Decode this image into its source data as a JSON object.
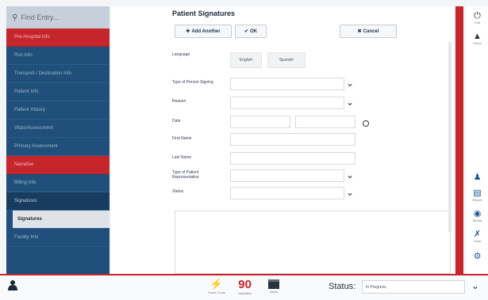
{
  "sidebar": {
    "search_placeholder": "Find Entry...",
    "items": [
      {
        "label": "Pre-Hospital Info"
      },
      {
        "label": "Run Info"
      },
      {
        "label": "Transport / Destination Info"
      },
      {
        "label": "Patient Info"
      },
      {
        "label": "Patient History"
      },
      {
        "label": "Vitals/Assessment"
      },
      {
        "label": "Primary Assessment"
      },
      {
        "label": "Narrative"
      },
      {
        "label": "Billing Info"
      },
      {
        "label": "Signatures"
      },
      {
        "label": "Signatures"
      },
      {
        "label": "Facility Info"
      }
    ]
  },
  "main": {
    "title": "Patient Signatures",
    "add_another": "Add Another",
    "ok": "OK",
    "cancel": "Cancel",
    "language_label": "Language",
    "lang_english": "English",
    "lang_spanish": "Spanish",
    "fields": [
      {
        "label": "Type of Person Signing"
      },
      {
        "label": "Reason"
      },
      {
        "label": "Date"
      },
      {
        "label": "First Name"
      },
      {
        "label": "Last Name"
      },
      {
        "label": "Type of Patient Representative"
      },
      {
        "label": "Status"
      }
    ]
  },
  "bottom": {
    "power_tools": "Power Tools",
    "vitals_value": "90",
    "vitals_caption": "Validation",
    "notes_caption": "Notes",
    "status_label": "Status:",
    "status_value": "In Progress"
  },
  "rightbar": {
    "items": [
      {
        "icon": "power-icon",
        "label": "Exit"
      },
      {
        "icon": "back-icon",
        "label": "Cloud"
      },
      {
        "icon": "person-icon",
        "label": ""
      },
      {
        "icon": "document-icon",
        "label": "Report"
      },
      {
        "icon": "camera-icon",
        "label": "Media"
      },
      {
        "icon": "tools-icon",
        "label": "Tools"
      },
      {
        "icon": "gear-icon",
        "label": ""
      }
    ]
  },
  "colors": {
    "accent_red": "#c5262c",
    "sidebar_blue": "#1f4f7a",
    "icon_blue": "#1e5a94"
  }
}
